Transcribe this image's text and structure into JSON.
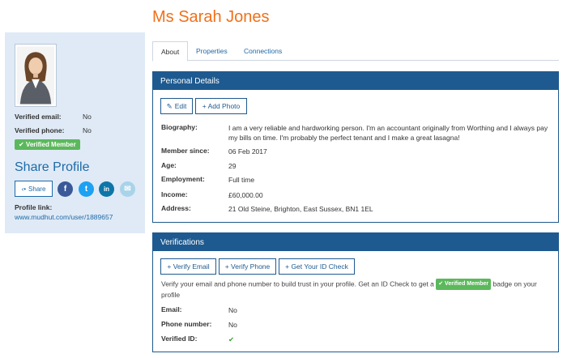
{
  "title": "Ms Sarah Jones",
  "sidebar": {
    "verified_email_label": "Verified email:",
    "verified_email_value": "No",
    "verified_phone_label": "Verified phone:",
    "verified_phone_value": "No",
    "verified_member_badge": "✔ Verified Member",
    "share_heading": "Share Profile",
    "share_button": "Share",
    "social": {
      "facebook": "f",
      "twitter": "t",
      "linkedin": "in",
      "email": "✉"
    },
    "profile_link_label": "Profile link:",
    "profile_link_url": "www.mudhut.com/user/1889657"
  },
  "tabs": [
    {
      "label": "About",
      "active": true
    },
    {
      "label": "Properties",
      "active": false
    },
    {
      "label": "Connections",
      "active": false
    }
  ],
  "personal": {
    "heading": "Personal Details",
    "edit_button": "Edit",
    "add_photo_button": "+ Add Photo",
    "rows": [
      {
        "label": "Biography:",
        "value": "I am a very reliable and hardworking person. I'm an accountant originally from Worthing and I always pay my bills on time. I'm probably the perfect tenant and I make a great lasagna!"
      },
      {
        "label": "Member since:",
        "value": "06 Feb 2017"
      },
      {
        "label": "Age:",
        "value": "29"
      },
      {
        "label": "Employment:",
        "value": "Full time"
      },
      {
        "label": "Income:",
        "value": "£60,000.00"
      },
      {
        "label": "Address:",
        "value": "21 Old Steine, Brighton, East Sussex, BN1 1EL"
      }
    ]
  },
  "verifications": {
    "heading": "Verifications",
    "verify_email_button": "+ Verify Email",
    "verify_phone_button": "+ Verify Phone",
    "id_check_button": "+ Get Your ID Check",
    "text_before": "Verify your email and phone number to build trust in your profile. Get an ID Check to get a",
    "badge": "✔ Verified Member",
    "text_after": "badge on your profile",
    "rows": [
      {
        "label": "Email:",
        "value": "No"
      },
      {
        "label": "Phone number:",
        "value": "No"
      },
      {
        "label": "Verified ID:",
        "value": "✔"
      }
    ]
  },
  "colors": {
    "accent_orange": "#f0701a",
    "primary_blue": "#1e5a8f",
    "success_green": "#5cb85c"
  }
}
